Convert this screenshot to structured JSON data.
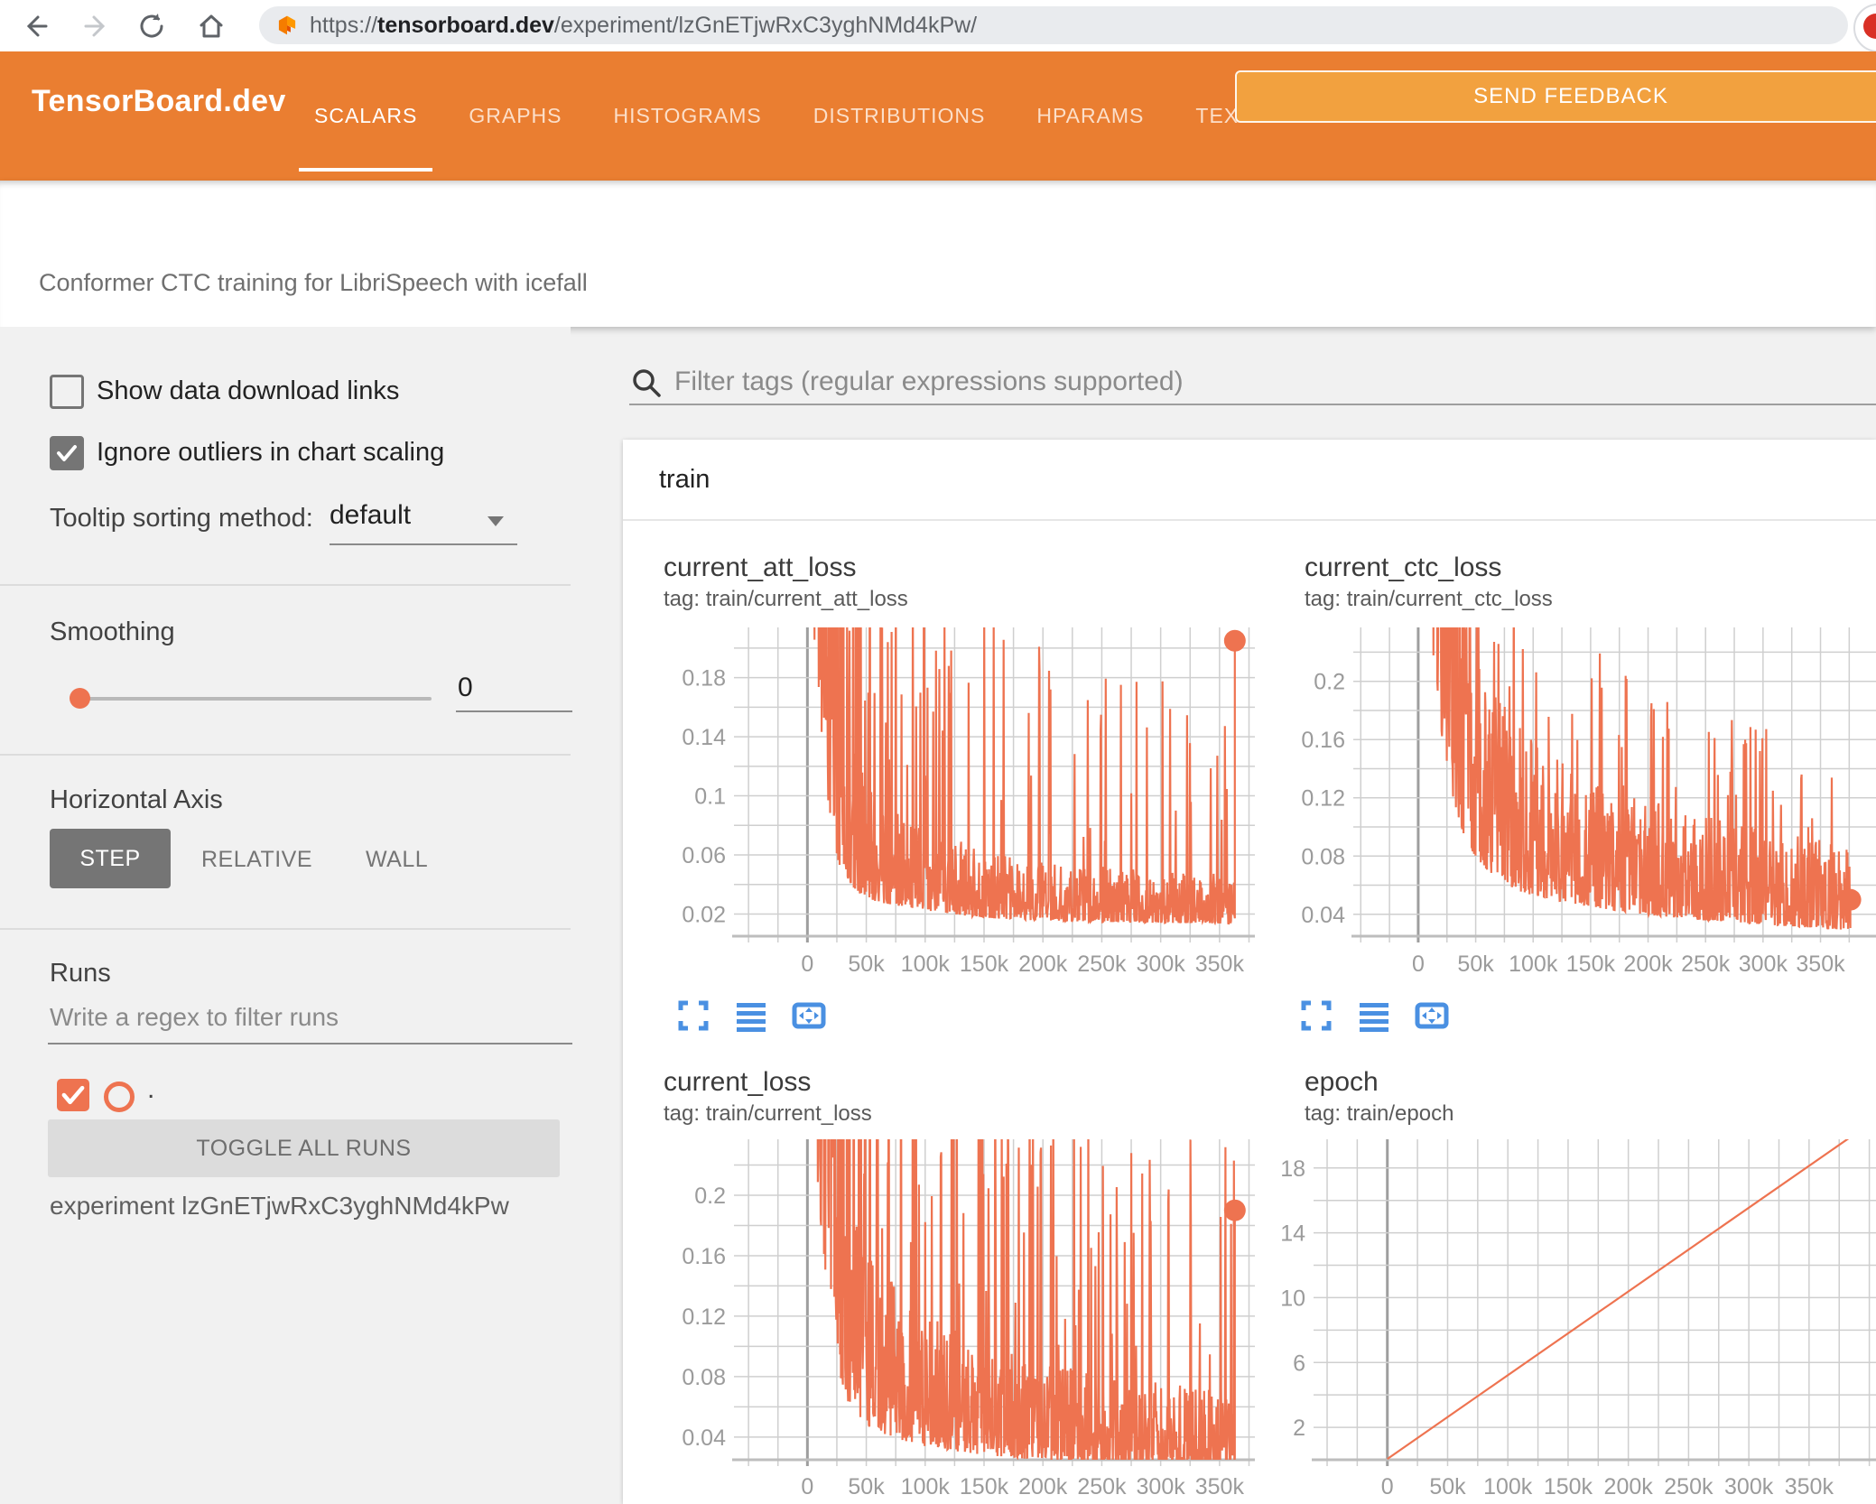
{
  "theme": {
    "header_bg": "#ea7e31",
    "feedback_bg": "#f2a13f",
    "run_color": "#ee7350",
    "icon_blue": "#4a90e2",
    "grid": "#cfcfcf",
    "zero_axis": "#9e9e9e",
    "bottom_axis": "#bdbdbd",
    "tick_text": "#9b9b9b"
  },
  "browser": {
    "url_prefix": "https://",
    "url_domain": "tensorboard.dev",
    "url_path": "/experiment/lzGnETjwRxC3yghNMd4kPw/"
  },
  "header": {
    "brand": "TensorBoard.dev",
    "tabs": [
      {
        "label": "SCALARS",
        "active": true
      },
      {
        "label": "GRAPHS",
        "active": false
      },
      {
        "label": "HISTOGRAMS",
        "active": false
      },
      {
        "label": "DISTRIBUTIONS",
        "active": false
      },
      {
        "label": "HPARAMS",
        "active": false
      },
      {
        "label": "TEXT",
        "active": false
      }
    ],
    "feedback_label": "SEND FEEDBACK"
  },
  "experiment": {
    "title": "Conformer CTC training for LibriSpeech with icefall"
  },
  "sidebar": {
    "show_data_download": {
      "label": "Show data download links",
      "checked": false
    },
    "ignore_outliers": {
      "label": "Ignore outliers in chart scaling",
      "checked": true
    },
    "tooltip_sorting": {
      "label": "Tooltip sorting method:",
      "value": "default"
    },
    "smoothing": {
      "label": "Smoothing",
      "value": "0"
    },
    "horizontal_axis": {
      "label": "Horizontal Axis",
      "selected": "STEP",
      "options": [
        "STEP",
        "RELATIVE",
        "WALL"
      ]
    },
    "runs": {
      "label": "Runs",
      "filter_placeholder": "Write a regex to filter runs",
      "run_name": ".",
      "toggle_label": "TOGGLE ALL RUNS",
      "experiment_label": "experiment lzGnETjwRxC3yghNMd4kPw"
    }
  },
  "main": {
    "filter_placeholder": "Filter tags (regular expressions supported)",
    "section_label": "train"
  },
  "chart_data": [
    {
      "type": "line",
      "title": "current_att_loss",
      "tag": "tag: train/current_att_loss",
      "xlabel": "step",
      "xlim": [
        -57000,
        380000
      ],
      "ylim": [
        0.005,
        0.214
      ],
      "x_tick_vals": [
        0,
        50000,
        100000,
        150000,
        200000,
        250000,
        300000,
        350000
      ],
      "x_tick_labels": [
        "0",
        "50k",
        "100k",
        "150k",
        "200k",
        "250k",
        "300k",
        "350k"
      ],
      "y_tick_vals": [
        0.02,
        0.06,
        0.1,
        0.14,
        0.18
      ],
      "y_tick_labels": [
        "0.02",
        "0.06",
        "0.1",
        "0.14",
        "0.18"
      ],
      "x_grid_step": 25000,
      "y_grid_step": 0.02,
      "grid": true,
      "series": [
        {
          "name": ".",
          "color": "#ee7350",
          "seed": 11,
          "n": 900,
          "x_start": 2000,
          "x_end": 363000,
          "trend": [
            [
              0,
              0.5
            ],
            [
              8000,
              0.36
            ],
            [
              15000,
              0.23
            ],
            [
              22000,
              0.135
            ],
            [
              30000,
              0.092
            ],
            [
              45000,
              0.066
            ],
            [
              60000,
              0.056
            ],
            [
              90000,
              0.048
            ],
            [
              120000,
              0.04
            ],
            [
              160000,
              0.034
            ],
            [
              200000,
              0.031
            ],
            [
              250000,
              0.029
            ],
            [
              300000,
              0.028
            ],
            [
              363000,
              0.027
            ]
          ],
          "noise": [
            0.5,
            1.8
          ],
          "spike_prob": [
            [
              0,
              0.3
            ],
            [
              30000,
              0.17
            ],
            [
              80000,
              0.1
            ],
            [
              150000,
              0.08
            ],
            [
              363000,
              0.07
            ]
          ],
          "spike": [
            2.2,
            6.5
          ],
          "end_dot": [
            363000,
            0.205
          ]
        }
      ]
    },
    {
      "type": "line",
      "title": "current_ctc_loss",
      "tag": "tag: train/current_ctc_loss",
      "xlabel": "step",
      "xlim": [
        -51000,
        447000
      ],
      "ylim": [
        0.025,
        0.237
      ],
      "x_tick_vals": [
        0,
        50000,
        100000,
        150000,
        200000,
        250000,
        300000,
        350000
      ],
      "x_tick_labels": [
        "0",
        "50k",
        "100k",
        "150k",
        "200k",
        "250k",
        "300k",
        "350k"
      ],
      "y_tick_vals": [
        0.04,
        0.08,
        0.12,
        0.16,
        0.2
      ],
      "y_tick_labels": [
        "0.04",
        "0.08",
        "0.12",
        "0.16",
        "0.2"
      ],
      "x_grid_step": 25000,
      "y_grid_step": 0.02,
      "grid": true,
      "series": [
        {
          "name": ".",
          "color": "#ee7350",
          "seed": 22,
          "n": 900,
          "x_start": 2000,
          "x_end": 376000,
          "trend": [
            [
              0,
              0.62
            ],
            [
              12000,
              0.4
            ],
            [
              20000,
              0.3
            ],
            [
              30000,
              0.22
            ],
            [
              40000,
              0.17
            ],
            [
              55000,
              0.132
            ],
            [
              70000,
              0.115
            ],
            [
              90000,
              0.1
            ],
            [
              120000,
              0.09
            ],
            [
              150000,
              0.082
            ],
            [
              200000,
              0.072
            ],
            [
              250000,
              0.065
            ],
            [
              300000,
              0.06
            ],
            [
              376000,
              0.053
            ]
          ],
          "noise": [
            0.55,
            1.65
          ],
          "spike_prob": [
            [
              0,
              0.22
            ],
            [
              50000,
              0.09
            ],
            [
              150000,
              0.055
            ],
            [
              376000,
              0.045
            ]
          ],
          "spike": [
            1.5,
            2.8
          ],
          "end_dot": [
            376000,
            0.05
          ]
        }
      ]
    },
    {
      "type": "line",
      "title": "current_loss",
      "tag": "tag: train/current_loss",
      "xlabel": "step",
      "xlim": [
        -57000,
        380000
      ],
      "ylim": [
        0.025,
        0.237
      ],
      "x_tick_vals": [
        0,
        50000,
        100000,
        150000,
        200000,
        250000,
        300000,
        350000
      ],
      "x_tick_labels": [
        "0",
        "50k",
        "100k",
        "150k",
        "200k",
        "250k",
        "300k",
        "350k"
      ],
      "y_tick_vals": [
        0.04,
        0.08,
        0.12,
        0.16,
        0.2
      ],
      "y_tick_labels": [
        "0.04",
        "0.08",
        "0.12",
        "0.16",
        "0.2"
      ],
      "x_grid_step": 25000,
      "y_grid_step": 0.02,
      "grid": true,
      "series": [
        {
          "name": ".",
          "color": "#ee7350",
          "seed": 33,
          "n": 900,
          "x_start": 2000,
          "x_end": 363000,
          "trend": [
            [
              0,
              0.55
            ],
            [
              10000,
              0.38
            ],
            [
              18000,
              0.26
            ],
            [
              26000,
              0.17
            ],
            [
              36000,
              0.12
            ],
            [
              50000,
              0.096
            ],
            [
              70000,
              0.08
            ],
            [
              100000,
              0.068
            ],
            [
              140000,
              0.058
            ],
            [
              180000,
              0.052
            ],
            [
              240000,
              0.046
            ],
            [
              300000,
              0.042
            ],
            [
              363000,
              0.04
            ]
          ],
          "noise": [
            0.5,
            1.8
          ],
          "spike_prob": [
            [
              0,
              0.27
            ],
            [
              40000,
              0.13
            ],
            [
              120000,
              0.085
            ],
            [
              363000,
              0.075
            ]
          ],
          "spike": [
            2,
            5.8
          ],
          "end_dot": [
            363000,
            0.19
          ]
        }
      ]
    },
    {
      "type": "line",
      "title": "epoch",
      "tag": "tag: train/epoch",
      "xlabel": "step",
      "xlim": [
        -56000,
        452000
      ],
      "ylim": [
        0,
        19.77
      ],
      "x_tick_vals": [
        0,
        50000,
        100000,
        150000,
        200000,
        250000,
        300000,
        350000
      ],
      "x_tick_labels": [
        "0",
        "50k",
        "100k",
        "150k",
        "200k",
        "250k",
        "300k",
        "350k"
      ],
      "y_tick_vals": [
        2,
        6,
        10,
        14,
        18
      ],
      "y_tick_labels": [
        "2",
        "6",
        "10",
        "14",
        "18"
      ],
      "x_grid_step": 25000,
      "y_grid_step": 2,
      "grid": true,
      "series": [
        {
          "name": ".",
          "color": "#ee7350",
          "points": [
            [
              0,
              0.05
            ],
            [
              390000,
              20.2
            ]
          ]
        }
      ]
    }
  ]
}
